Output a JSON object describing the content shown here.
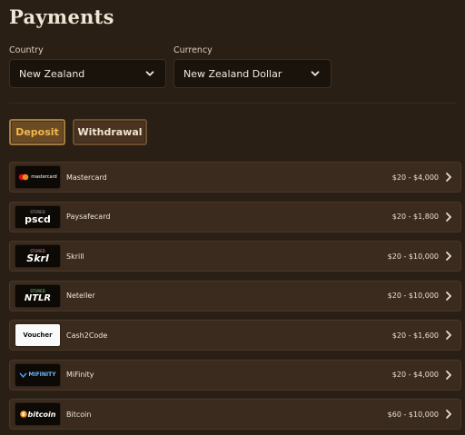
{
  "header": {
    "title": "Payments"
  },
  "country": {
    "label": "Country",
    "value": "New Zealand"
  },
  "currency": {
    "label": "Currency",
    "value": "New Zealand Dollar"
  },
  "tabs": {
    "deposit": "Deposit",
    "withdrawal": "Withdrawal"
  },
  "methods": [
    {
      "name": "Mastercard",
      "range": "$20 - $4,000",
      "logo_icon": "mastercard-logo",
      "logo_text": "mastercard"
    },
    {
      "name": "Paysafecard",
      "range": "$20 - $1,800",
      "logo_icon": "paysafecard-logo",
      "logo_text": "pscd",
      "logo_caption": "STORED"
    },
    {
      "name": "Skrill",
      "range": "$20 - $10,000",
      "logo_icon": "skrill-logo",
      "logo_text": "Skrl",
      "logo_caption": "STORED"
    },
    {
      "name": "Neteller",
      "range": "$20 - $10,000",
      "logo_icon": "neteller-logo",
      "logo_text": "NTLR",
      "logo_caption": "STORED"
    },
    {
      "name": "Cash2Code",
      "range": "$20 - $1,600",
      "logo_icon": "voucher-logo",
      "logo_text": "Voucher"
    },
    {
      "name": "MiFinity",
      "range": "$20 - $4,000",
      "logo_icon": "mifinity-logo",
      "logo_text": "MIFINITY"
    },
    {
      "name": "Bitcoin",
      "range": "$60 - $10,000",
      "logo_icon": "bitcoin-logo",
      "logo_text": "bitcoin"
    }
  ],
  "colors": {
    "background": "#2a1f15",
    "row": "#3a2b1e",
    "accent": "#f0b94b"
  }
}
